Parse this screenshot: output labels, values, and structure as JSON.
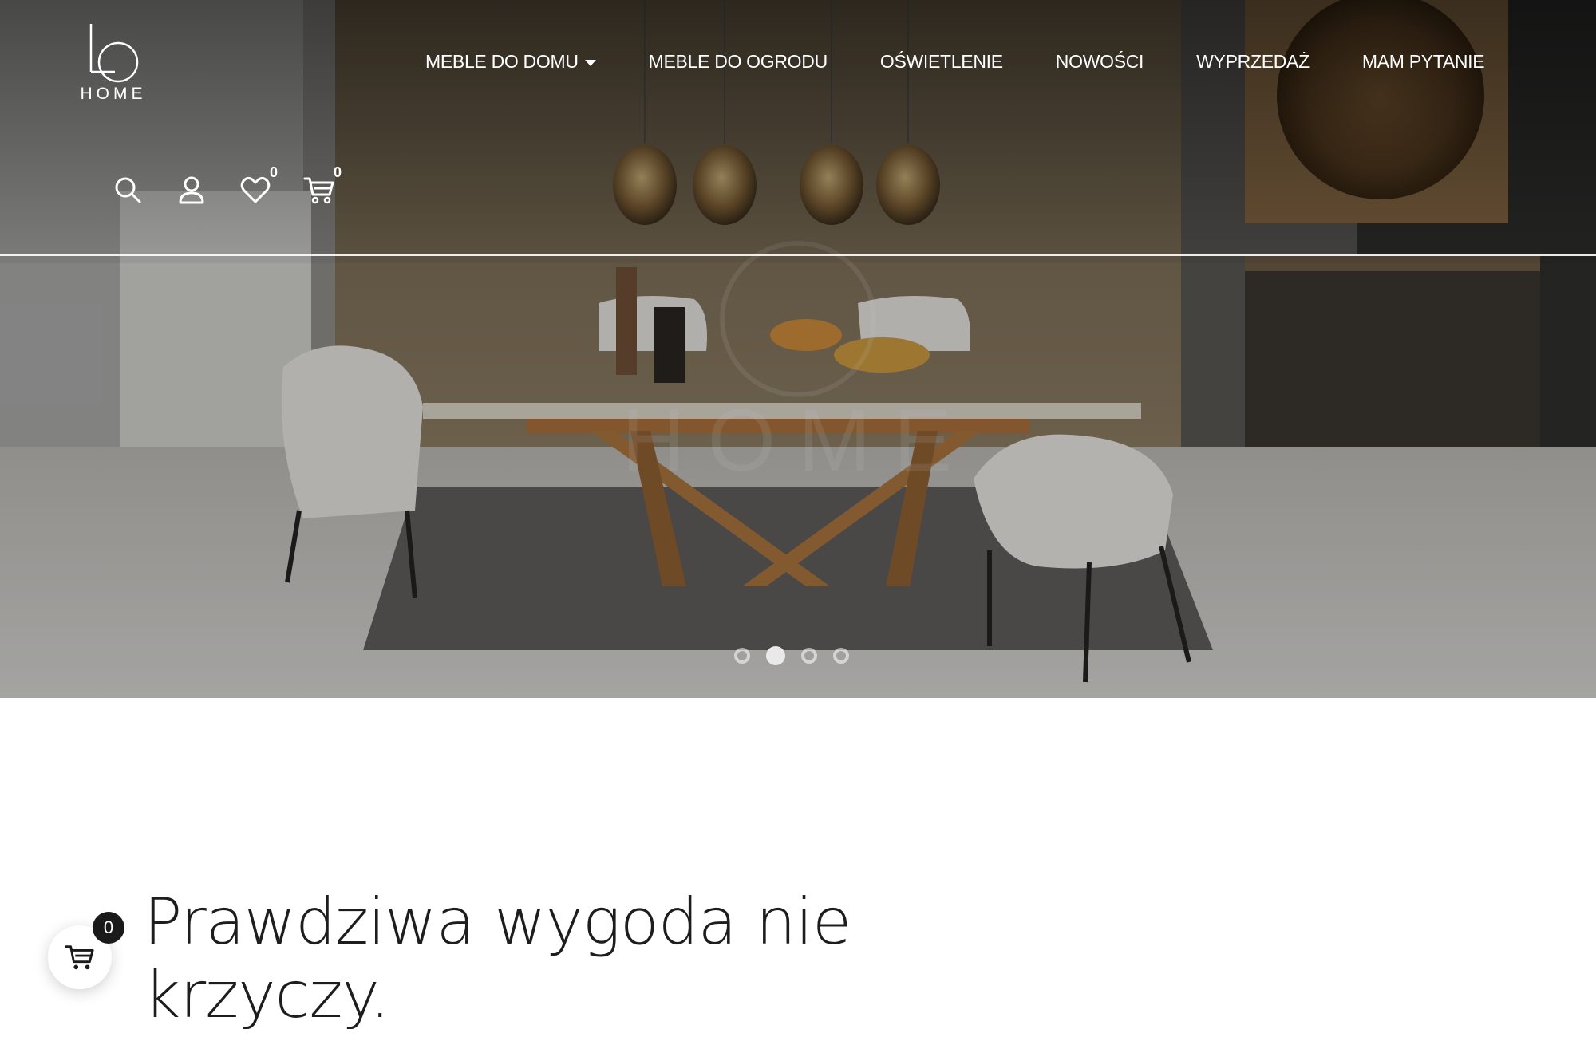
{
  "brand": {
    "logo_mark": "LO",
    "logo_text": "HOME"
  },
  "nav": {
    "items": [
      {
        "label": "MEBLE DO DOMU",
        "has_dropdown": true
      },
      {
        "label": "MEBLE DO OGRODU",
        "has_dropdown": false
      },
      {
        "label": "OŚWIETLENIE",
        "has_dropdown": false
      },
      {
        "label": "NOWOŚCI",
        "has_dropdown": false
      },
      {
        "label": "WYPRZEDAŻ",
        "has_dropdown": false
      },
      {
        "label": "MAM PYTANIE",
        "has_dropdown": false
      }
    ]
  },
  "header_icons": {
    "search": "search-icon",
    "account": "user-icon",
    "wishlist": {
      "icon": "heart-icon",
      "count": "0"
    },
    "cart": {
      "icon": "cart-icon",
      "count": "0"
    }
  },
  "hero": {
    "watermark": "HOME",
    "slides_total": 4,
    "active_slide": 2
  },
  "content": {
    "headline": "Prawdziwa wygoda nie krzyczy."
  },
  "floating_cart": {
    "icon": "cart-icon",
    "count": "0"
  },
  "colors": {
    "header_text": "#ffffff",
    "headline_text": "#1d1d1d",
    "badge_bg": "#1a1a1a"
  }
}
